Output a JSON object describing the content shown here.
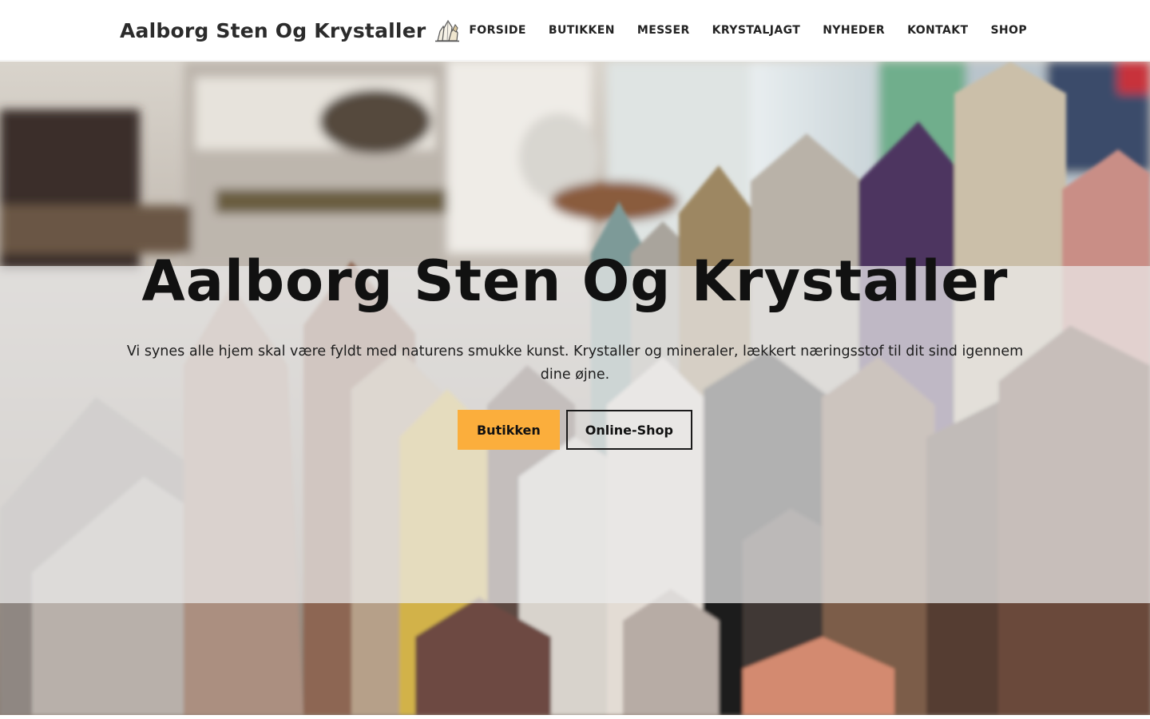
{
  "header": {
    "brand": "Aalborg Sten Og Krystaller",
    "logo_icon": "crystal-cluster-icon",
    "nav": [
      "FORSIDE",
      "BUTIKKEN",
      "MESSER",
      "KRYSTALJAGT",
      "NYHEDER",
      "KONTAKT",
      "SHOP"
    ]
  },
  "hero": {
    "title": "Aalborg Sten Og Krystaller",
    "text": "Vi synes alle hjem skal være fyldt med naturens smukke kunst. Krystaller og mineraler, lækkert næringsstof til dit sind igennem dine øjne.",
    "buttons": {
      "primary": "Butikken",
      "secondary": "Online-Shop"
    }
  },
  "colors": {
    "accent": "#fbae3c",
    "text": "#111111",
    "overlay": "#ececec"
  }
}
